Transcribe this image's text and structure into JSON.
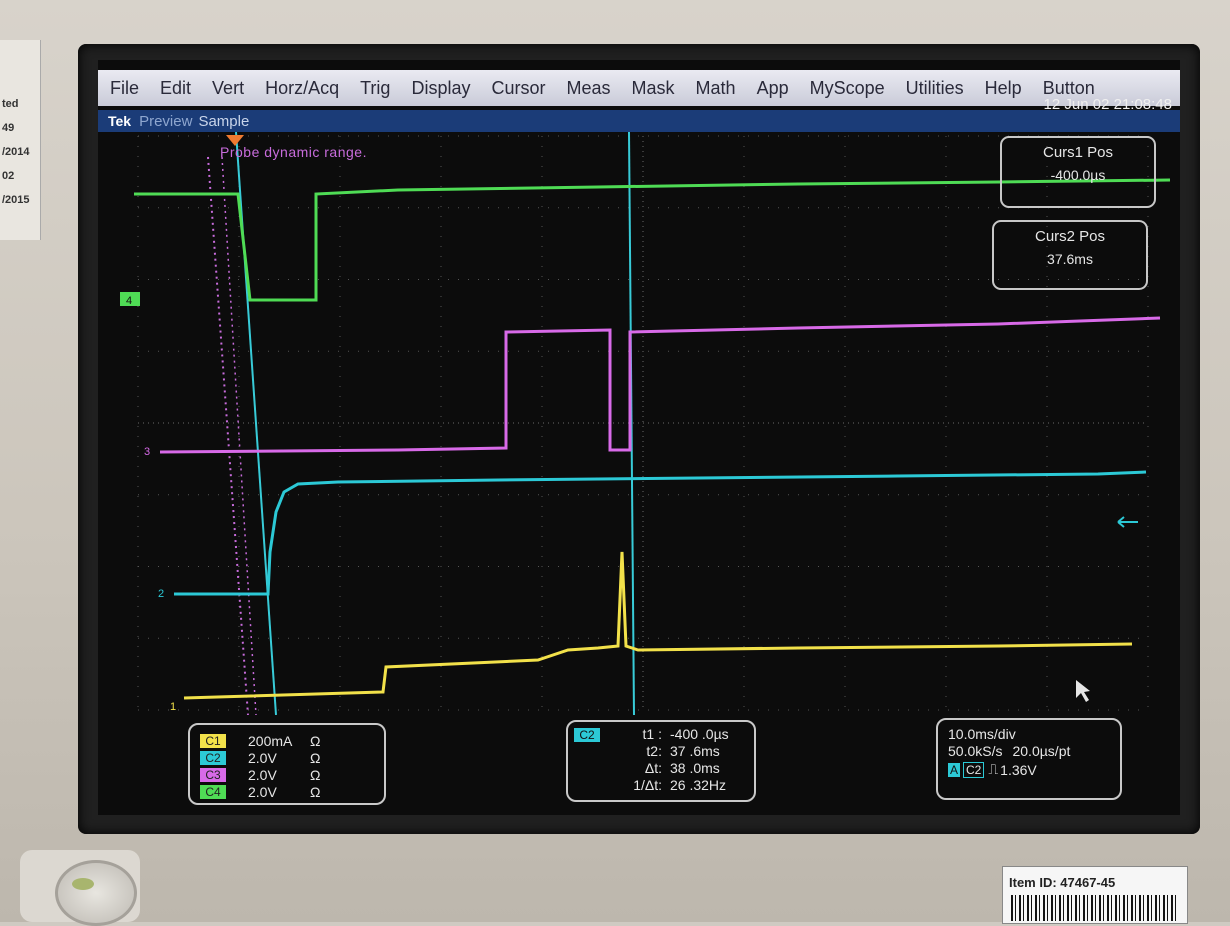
{
  "left_strip": {
    "lines": [
      "ted",
      "49",
      "/2014",
      "02",
      "/2015"
    ]
  },
  "menu": {
    "items": [
      "File",
      "Edit",
      "Vert",
      "Horz/Acq",
      "Trig",
      "Display",
      "Cursor",
      "Meas",
      "Mask",
      "Math",
      "App",
      "MyScope",
      "Utilities",
      "Help",
      "Button"
    ]
  },
  "status": {
    "brand": "Tek",
    "mode": "Preview",
    "acq": "Sample",
    "datetime": "12 Jun 02 21:08:48"
  },
  "probe_message": "Probe dynamic range.",
  "cursors": {
    "curs1": {
      "title": "Curs1 Pos",
      "value": "-400.0µs"
    },
    "curs2": {
      "title": "Curs2 Pos",
      "value": "37.6ms"
    }
  },
  "markers": {
    "ch4": "4",
    "ch3": "3",
    "ch2": "2",
    "ch1": "1"
  },
  "channels": [
    {
      "tag": "C1",
      "scale": "200mA",
      "unit": "Ω",
      "color": "#f2e14a"
    },
    {
      "tag": "C2",
      "scale": "2.0V",
      "unit": "Ω",
      "color": "#2cc9d6"
    },
    {
      "tag": "C3",
      "scale": "2.0V",
      "unit": "Ω",
      "color": "#d86ae8"
    },
    {
      "tag": "C4",
      "scale": "2.0V",
      "unit": "Ω",
      "color": "#4fdc55"
    }
  ],
  "measurement": {
    "source": "C2",
    "rows": [
      {
        "k": "t1 :",
        "v": "-400 .0µs"
      },
      {
        "k": "t2:",
        "v": "37 .6ms"
      },
      {
        "k": "Δt:",
        "v": "38 .0ms"
      },
      {
        "k": "1/Δt:",
        "v": "26 .32Hz"
      }
    ]
  },
  "timebase": {
    "tdiv": "10.0ms/div",
    "rate": "50.0kS/s",
    "pt": "20.0µs/pt",
    "trig_a": "A",
    "trig_ch": "C2",
    "trig_level": "1.36V",
    "trig_slope": "⎍"
  },
  "item_label": {
    "text": "Item ID:  47467-45"
  },
  "colors": {
    "ch1": "#f2e14a",
    "ch2": "#2cc9d6",
    "ch3": "#d86ae8",
    "ch4": "#4fdc55",
    "menubar": "#dcdde8",
    "statusbar": "#1b3c78"
  }
}
